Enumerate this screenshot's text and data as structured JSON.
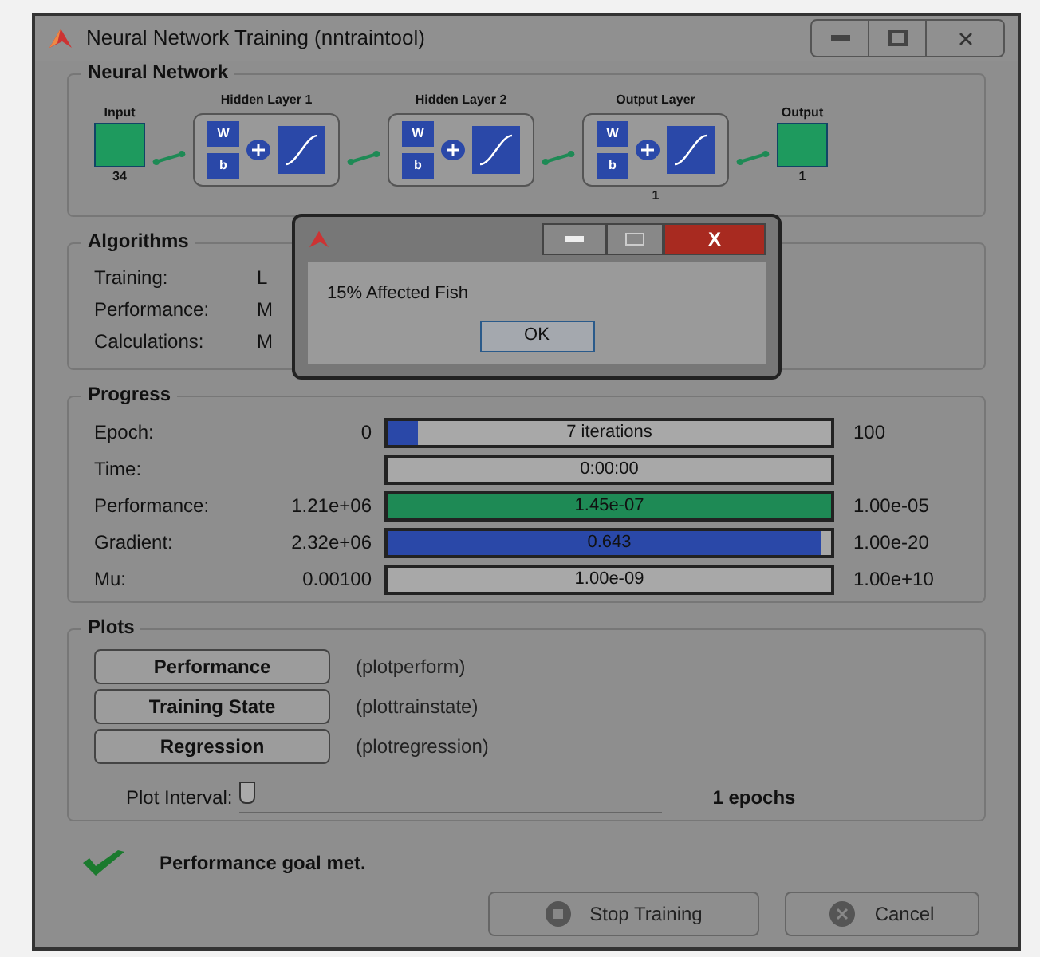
{
  "window": {
    "title": "Neural Network Training (nntraintool)"
  },
  "network": {
    "title": "Neural Network",
    "input": {
      "label": "Input",
      "size": "34"
    },
    "layers": [
      {
        "name": "Hidden Layer 1",
        "w": "W",
        "b": "b"
      },
      {
        "name": "Hidden Layer 2",
        "w": "W",
        "b": "b"
      },
      {
        "name": "Output Layer",
        "w": "W",
        "b": "b",
        "size": "1"
      }
    ],
    "output": {
      "label": "Output",
      "size": "1"
    }
  },
  "algorithms": {
    "title": "Algorithms",
    "rows": [
      {
        "label": "Training:",
        "value": "L"
      },
      {
        "label": "Performance:",
        "value": "M"
      },
      {
        "label": "Calculations:",
        "value": "M"
      }
    ]
  },
  "progress": {
    "title": "Progress",
    "rows": [
      {
        "label": "Epoch:",
        "start": "0",
        "bar_text": "7 iterations",
        "level": 0.07,
        "kind": "blue",
        "end": "100"
      },
      {
        "label": "Time:",
        "bar_text": "0:00:00"
      },
      {
        "label": "Performance:",
        "start": "1.21e+06",
        "bar_text": "1.45e-07",
        "level": 1,
        "kind": "green",
        "end": "1.00e-05"
      },
      {
        "label": "Gradient:",
        "start": "2.32e+06",
        "bar_text": "0.643",
        "level": 0.98,
        "kind": "blue",
        "end": "1.00e-20"
      },
      {
        "label": "Mu:",
        "start": "0.00100",
        "bar_text": "1.00e-09",
        "end": "1.00e+10"
      }
    ]
  },
  "plots": {
    "title": "Plots",
    "buttons": [
      {
        "label": "Performance",
        "function": "(plotperform)"
      },
      {
        "label": "Training State",
        "function": "(plottrainstate)"
      },
      {
        "label": "Regression",
        "function": "(plotregression)"
      }
    ],
    "interval": {
      "label": "Plot Interval:",
      "level": 0,
      "reading": "1 epochs"
    }
  },
  "status": {
    "text": "Performance goal met.",
    "success": true
  },
  "buttons": [
    {
      "label": "Stop Training",
      "kind": "stop"
    },
    {
      "label": "Cancel",
      "kind": "cancel"
    }
  ],
  "dialog": {
    "message": "15% Affected Fish",
    "button": "OK",
    "close": "X"
  }
}
